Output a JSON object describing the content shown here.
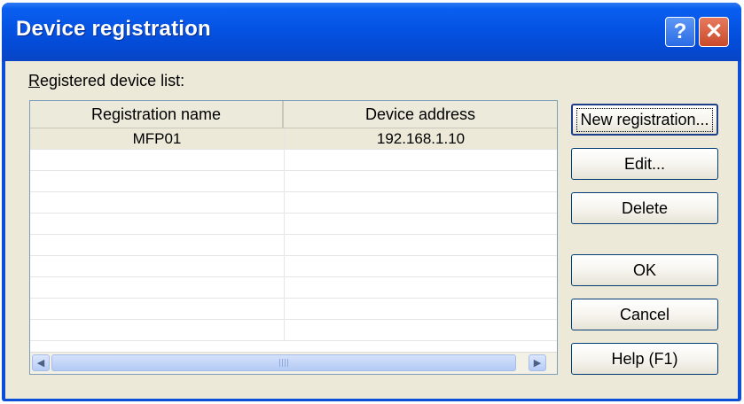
{
  "window": {
    "title": "Device registration",
    "help_glyph": "?",
    "close_glyph": "✕"
  },
  "list": {
    "label": "Registered device list:",
    "label_accesskey": "R",
    "label_rest": "egistered device list:",
    "columns": [
      "Registration name",
      "Device address"
    ],
    "rows": [
      [
        "MFP01",
        "192.168.1.10"
      ],
      [
        "",
        ""
      ],
      [
        "",
        ""
      ],
      [
        "",
        ""
      ],
      [
        "",
        ""
      ],
      [
        "",
        ""
      ],
      [
        "",
        ""
      ],
      [
        "",
        ""
      ],
      [
        "",
        ""
      ],
      [
        "",
        ""
      ]
    ],
    "scroll_left_glyph": "◀",
    "scroll_right_glyph": "▶"
  },
  "buttons": {
    "new_registration": "New registration...",
    "edit": "Edit...",
    "delete": "Delete",
    "ok": "OK",
    "cancel": "Cancel",
    "help": "Help (F1)"
  }
}
